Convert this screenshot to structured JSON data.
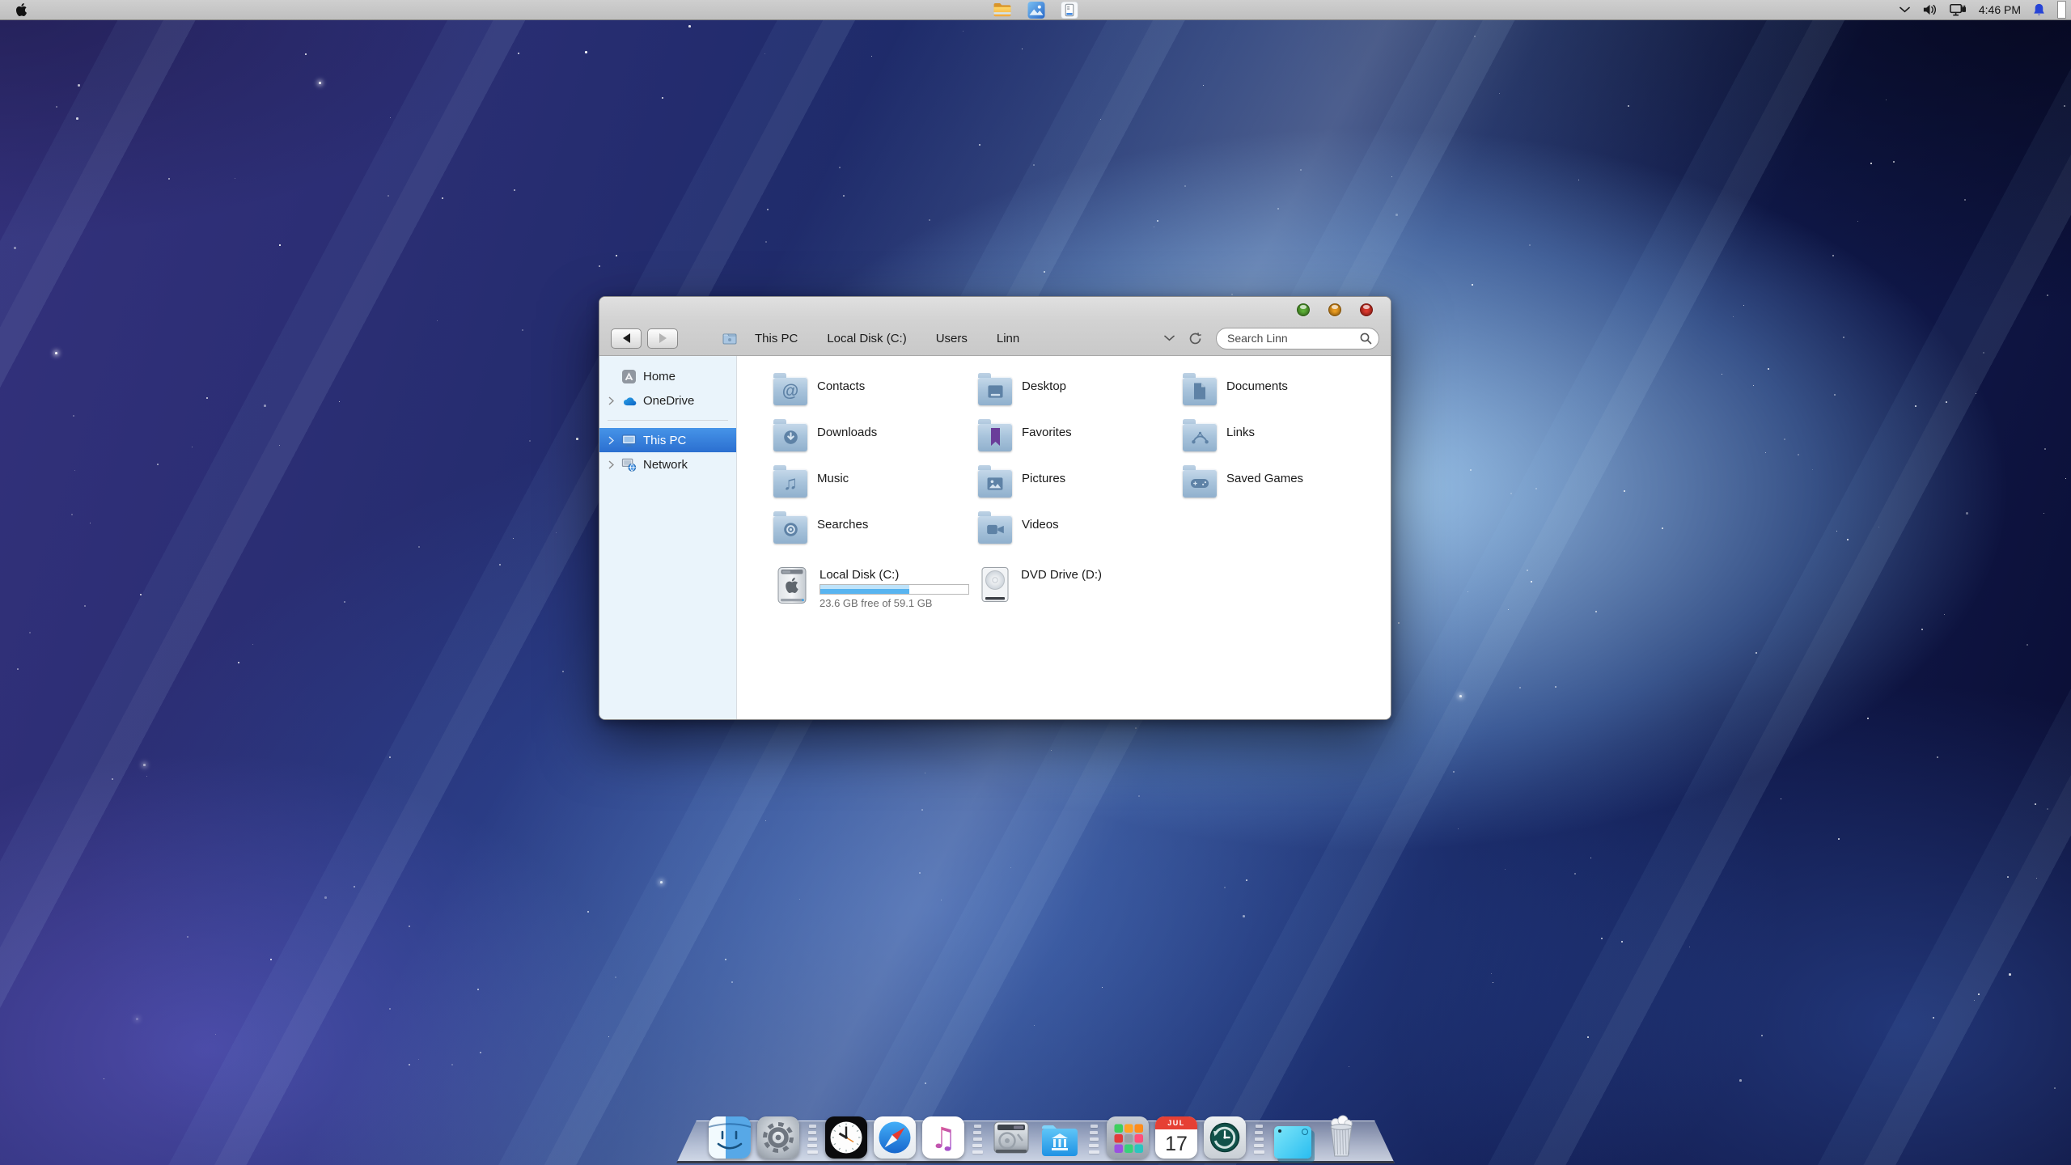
{
  "menubar": {
    "apple_menu_icon": "apple-icon",
    "center_apps": [
      {
        "name": "file-explorer",
        "icon": "file-explorer-icon"
      },
      {
        "name": "photos",
        "icon": "photos-icon"
      },
      {
        "name": "device-manager",
        "icon": "device-app-icon"
      }
    ],
    "tray": {
      "hidden_icons_icon": "chevron-down-icon",
      "volume_icon": "speaker-icon",
      "network_icon": "network-monitor-icon",
      "time": "4:46 PM",
      "notifications_icon": "bell-icon",
      "notification_color": "#2744d6",
      "show_desktop_icon": "show-desktop-sliver"
    }
  },
  "window": {
    "traffic_lights": [
      {
        "action": "zoom",
        "color": "#61b53a",
        "edge": "#3c7a1d"
      },
      {
        "action": "minimize",
        "color": "#f0a224",
        "edge": "#b06e0e"
      },
      {
        "action": "close",
        "color": "#e23b30",
        "edge": "#9e1f16"
      }
    ],
    "toolbar": {
      "back_icon": "back-arrow-icon",
      "forward_icon": "forward-arrow-icon",
      "location_icon": "small-folder-icon",
      "breadcrumb": [
        "This PC",
        "Local Disk (C:)",
        "Users",
        "Linn"
      ],
      "address_dropdown_icon": "chevron-down-icon",
      "refresh_icon": "refresh-icon",
      "search": {
        "placeholder": "Search Linn",
        "icon": "search-icon"
      }
    },
    "sidebar": {
      "selected_color": "#2f7cd6",
      "items": [
        {
          "label": "Home",
          "icon": "home-icon",
          "expander": false,
          "selected": false
        },
        {
          "label": "OneDrive",
          "icon": "onedrive-cloud-icon",
          "expander": true,
          "selected": false
        },
        {
          "divider": true
        },
        {
          "label": "This PC",
          "icon": "this-pc-monitor-icon",
          "expander": true,
          "selected": true
        },
        {
          "label": "Network",
          "icon": "network-globe-icon",
          "expander": true,
          "selected": false
        }
      ]
    },
    "folders": [
      {
        "label": "Contacts",
        "glyph": "at-sign-glyph"
      },
      {
        "label": "Desktop",
        "glyph": "desktop-window-glyph"
      },
      {
        "label": "Documents",
        "glyph": "document-glyph"
      },
      {
        "label": "Downloads",
        "glyph": "download-arrow-glyph"
      },
      {
        "label": "Favorites",
        "glyph": "bookmark-ribbon-glyph",
        "glyph_color": "#6a3d9a"
      },
      {
        "label": "Links",
        "glyph": "bezier-curve-glyph"
      },
      {
        "label": "Music",
        "glyph": "music-note-glyph"
      },
      {
        "label": "Pictures",
        "glyph": "photo-glyph"
      },
      {
        "label": "Saved Games",
        "glyph": "gamepad-glyph"
      },
      {
        "label": "Searches",
        "glyph": "lens-glyph"
      },
      {
        "label": "Videos",
        "glyph": "video-camera-glyph"
      }
    ],
    "drives": [
      {
        "label": "Local Disk (C:)",
        "icon": "hard-drive-icon",
        "capacity_text": "23.6 GB free of 59.1 GB",
        "used_percent": 60,
        "bar_color": "#58b4f0"
      },
      {
        "label": "DVD Drive (D:)",
        "icon": "dvd-drive-icon"
      }
    ]
  },
  "dock": {
    "items": [
      {
        "name": "finder",
        "icon": "finder-icon"
      },
      {
        "name": "system-settings",
        "icon": "gear-icon"
      },
      {
        "separator": true
      },
      {
        "name": "clock",
        "icon": "clock-icon"
      },
      {
        "name": "safari",
        "icon": "safari-compass-icon"
      },
      {
        "name": "music",
        "icon": "music-note-icon"
      },
      {
        "separator": true
      },
      {
        "name": "internal-drive",
        "icon": "hard-drive-icon"
      },
      {
        "name": "library-folder",
        "icon": "library-folder-icon"
      },
      {
        "separator": true
      },
      {
        "name": "launchpad",
        "icon": "launchpad-grid-icon"
      },
      {
        "name": "calendar",
        "icon": "calendar-icon",
        "month": "JUL",
        "day": "17"
      },
      {
        "name": "time-machine",
        "icon": "time-machine-icon"
      },
      {
        "separator": true
      },
      {
        "name": "stickies",
        "icon": "sticky-note-icon"
      },
      {
        "name": "trash-full",
        "icon": "trash-icon"
      }
    ]
  }
}
